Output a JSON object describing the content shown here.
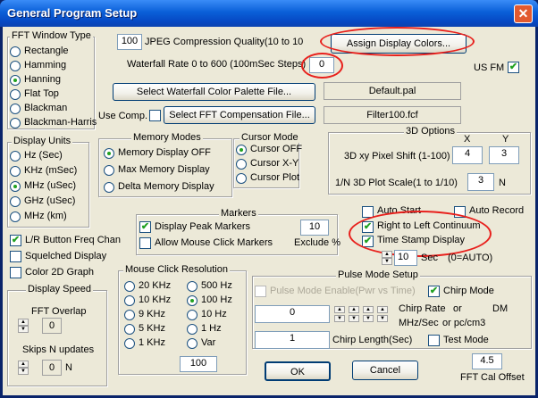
{
  "window": {
    "title": "General Program Setup",
    "close_glyph": "✕"
  },
  "fft_window": {
    "title": "FFT Window Type",
    "options": [
      "Rectangle",
      "Hamming",
      "Hanning",
      "Flat Top",
      "Blackman",
      "Blackman-Harris"
    ],
    "selected": "Hanning"
  },
  "display_units": {
    "title": "Display Units",
    "options": [
      "Hz (Sec)",
      "KHz (mSec)",
      "MHz (uSec)",
      "GHz (uSec)",
      "MHz (km)"
    ],
    "selected": "MHz (uSec)"
  },
  "checks_left": {
    "lr_button": "L/R Button Freq Chan",
    "squelched": "Squelched Display",
    "color2d": "Color 2D Graph"
  },
  "display_speed": {
    "title": "Display Speed",
    "fft_overlap_label": "FFT Overlap",
    "fft_overlap_value": "0",
    "skips_label": "Skips N updates",
    "skips_value": "0",
    "skips_unit": "N"
  },
  "jpeg": {
    "value": "100",
    "label": "JPEG Compression Quality(10 to 10"
  },
  "waterfall_rate": {
    "label": "Waterfall Rate 0 to 600 (100mSec Steps)",
    "value": "0"
  },
  "assign_colors_button": "Assign Display Colors...",
  "us_fm": {
    "label": "US FM",
    "checked": true
  },
  "palette": {
    "button": "Select Waterfall Color Palette File...",
    "value": "Default.pal"
  },
  "compensation": {
    "use_label": "Use Comp.",
    "button": "Select FFT Compensation File...",
    "value": "Filter100.fcf"
  },
  "memory_modes": {
    "title": "Memory Modes",
    "options": [
      "Memory Display OFF",
      "Max Memory Display",
      "Delta Memory Display"
    ],
    "selected": "Memory Display OFF"
  },
  "cursor_mode": {
    "title": "Cursor Mode",
    "options": [
      "Cursor OFF",
      "Cursor X-Y",
      "Cursor Plot"
    ],
    "selected": "Cursor OFF"
  },
  "options_3d": {
    "title": "3D Options",
    "x_header": "X",
    "y_header": "Y",
    "pixel_shift_label": "3D xy Pixel Shift (1-100)",
    "x_value": "4",
    "y_value": "3",
    "scale_label": "1/N 3D Plot Scale(1 to 1/10)",
    "scale_value": "3",
    "scale_unit": "N"
  },
  "markers": {
    "title": "Markers",
    "display_peak": "Display Peak Markers",
    "peak_count": "10",
    "allow_click": "Allow Mouse Click Markers",
    "exclude_label": "Exclude %"
  },
  "auto": {
    "auto_start": "Auto Start",
    "auto_record": "Auto Record",
    "right_to_left": "Right to Left Continuum",
    "time_stamp": "Time Stamp Display",
    "sec_value": "10",
    "sec_label": "Sec",
    "auto_note": "(0=AUTO)"
  },
  "mouse_click": {
    "title": "Mouse Click Resolution",
    "left_options": [
      "20 KHz",
      "10 KHz",
      "9 KHz",
      "5 KHz",
      "1 KHz"
    ],
    "right_options": [
      "500 Hz",
      "100 Hz",
      "10 Hz",
      "1 Hz",
      "Var"
    ],
    "selected": "100 Hz",
    "var_value": "100"
  },
  "pulse_mode": {
    "title": "Pulse Mode Setup",
    "enable_label": "Pulse Mode Enable(Pwr vs Time)",
    "chirp_mode": "Chirp Mode",
    "rate_value": "0",
    "chirp_rate_label": "Chirp Rate",
    "or_label": "or",
    "dm_label": "DM",
    "units_label": "MHz/Sec",
    "or_pc_label": "or pc/cm3",
    "chirp_length_value": "1",
    "chirp_length_label": "Chirp Length(Sec)",
    "test_mode": "Test Mode"
  },
  "ok_button": "OK",
  "cancel_button": "Cancel",
  "fft_cal": {
    "value": "4.5",
    "label": "FFT Cal Offset"
  },
  "colors": {
    "highlight_ellipse": "#e8201c",
    "check_mark": "#21a121",
    "titlebar": "#0a5fd8"
  }
}
